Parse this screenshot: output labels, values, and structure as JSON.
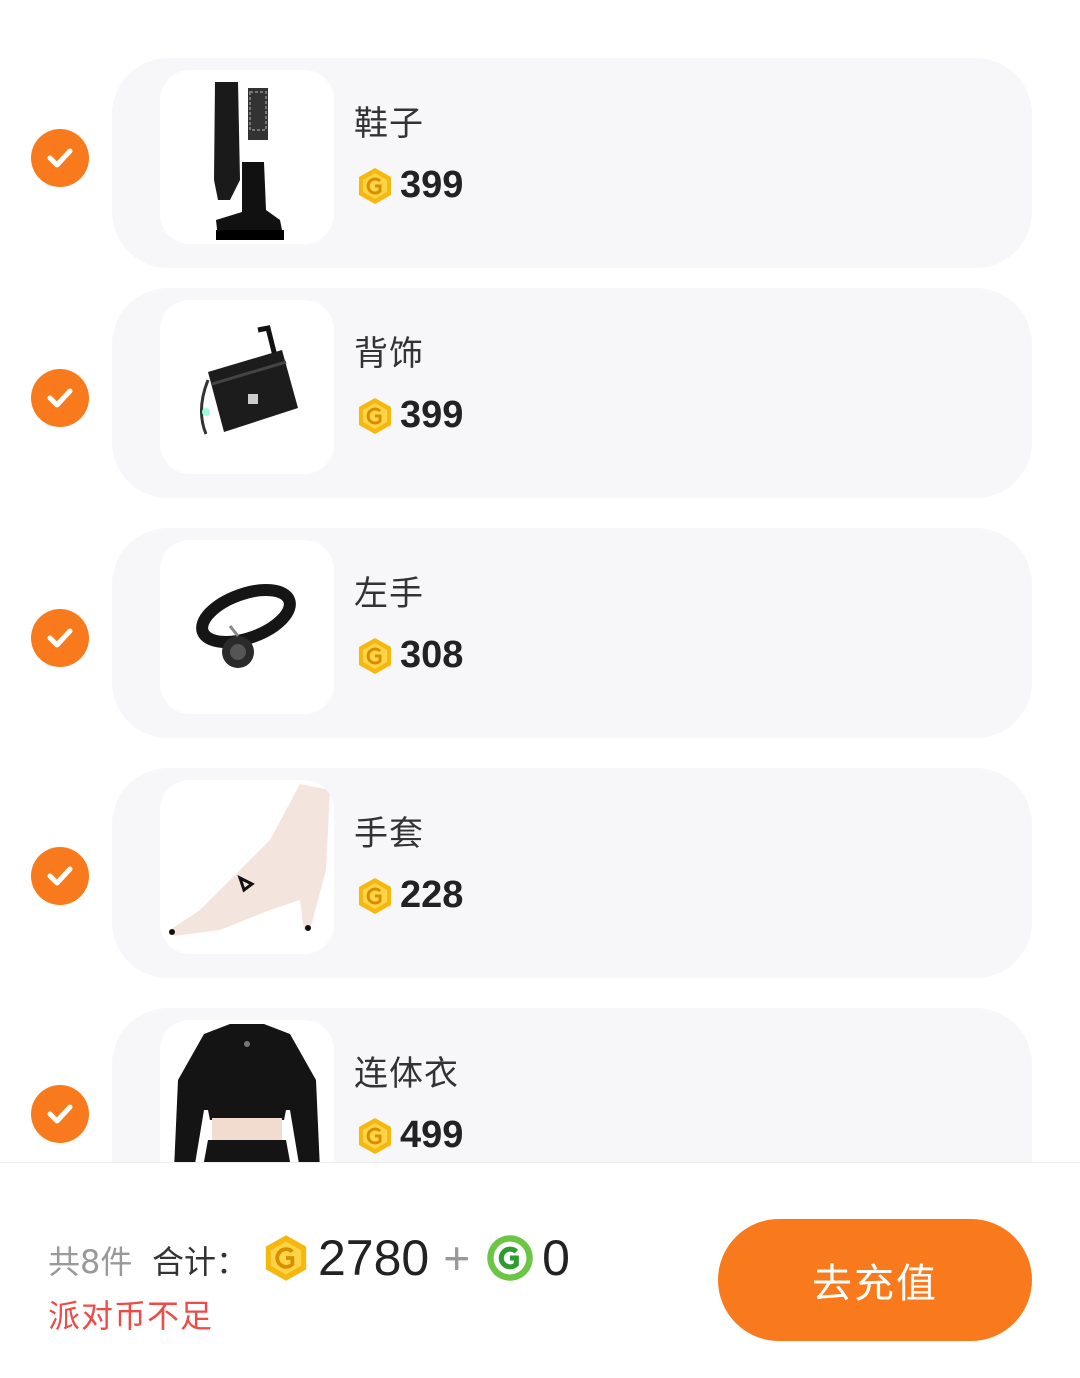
{
  "colors": {
    "accent": "#f97a1c",
    "warning": "#ee4b47",
    "gold_coin": "#f5b80f",
    "green_coin": "#6cc644",
    "card_bg": "#f7f7f9"
  },
  "items": [
    {
      "name": "鞋子",
      "price": "399",
      "checked": true,
      "image": "boots-image"
    },
    {
      "name": "背饰",
      "price": "399",
      "checked": true,
      "image": "bag-image"
    },
    {
      "name": "左手",
      "price": "308",
      "checked": true,
      "image": "bracelet-image"
    },
    {
      "name": "手套",
      "price": "228",
      "checked": true,
      "image": "glove-image"
    },
    {
      "name": "连体衣",
      "price": "499",
      "checked": true,
      "image": "jumpsuit-image"
    }
  ],
  "footer": {
    "count_text": "共8件",
    "total_label": "合计：",
    "gold_total": "2780",
    "plus": "+",
    "green_total": "0",
    "warning": "派对币不足",
    "recharge_label": "去充值"
  },
  "icons": {
    "check": "check-icon",
    "gold": "gold-coin-icon",
    "green": "green-coin-icon"
  }
}
